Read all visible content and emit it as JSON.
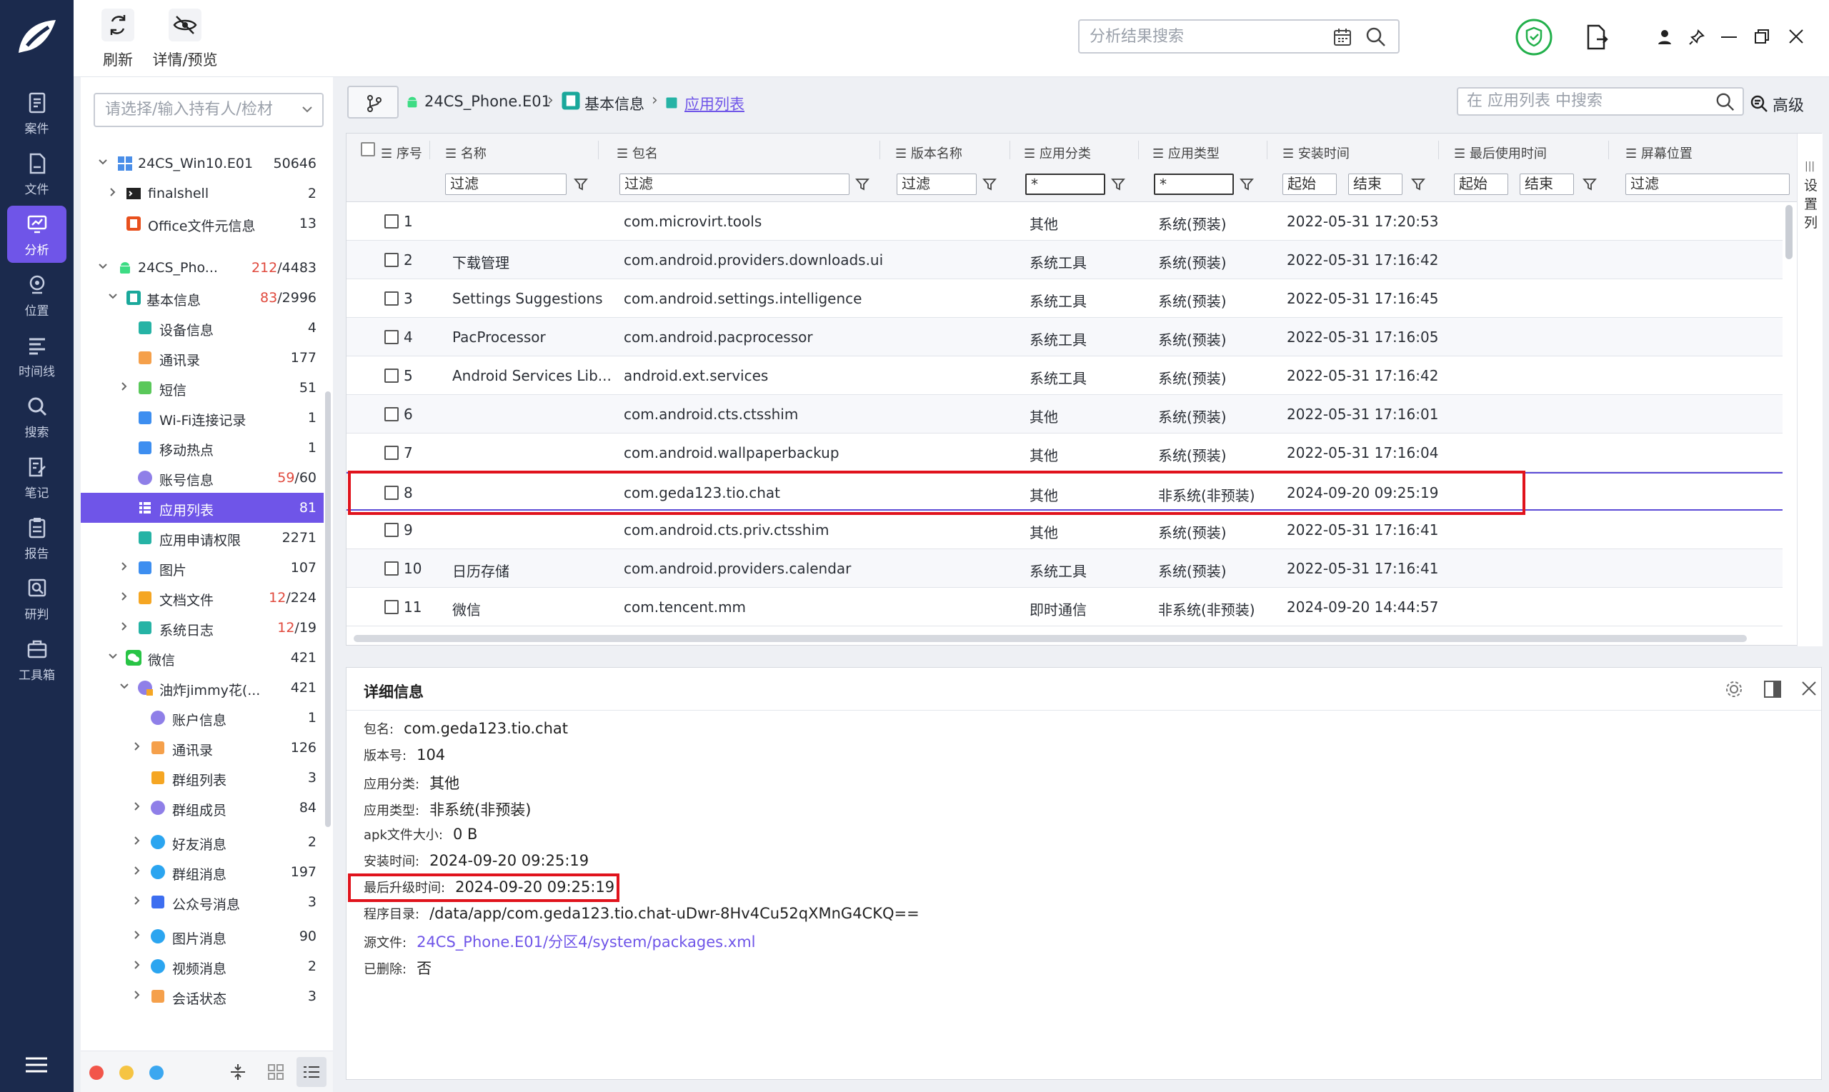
{
  "nav": {
    "items": [
      {
        "label": "案件",
        "icon": "case-icon"
      },
      {
        "label": "文件",
        "icon": "file-icon"
      },
      {
        "label": "分析",
        "icon": "analysis-icon",
        "active": true
      },
      {
        "label": "位置",
        "icon": "location-icon"
      },
      {
        "label": "时间线",
        "icon": "timeline-icon"
      },
      {
        "label": "搜索",
        "icon": "search-icon"
      },
      {
        "label": "笔记",
        "icon": "note-icon"
      },
      {
        "label": "报告",
        "icon": "report-icon"
      },
      {
        "label": "研判",
        "icon": "judge-icon"
      },
      {
        "label": "工具箱",
        "icon": "toolbox-icon"
      }
    ]
  },
  "toolbar": {
    "refresh_label": "刷新",
    "detail_label": "详情/预览",
    "search_placeholder": "分析结果搜索"
  },
  "tree": {
    "holder_placeholder": "请选择/输入持有人/检材",
    "rows": [
      {
        "label": "24CS_Win10.E01",
        "count": "50646"
      },
      {
        "label": "finalshell",
        "count": "2"
      },
      {
        "label": "Office文件元信息",
        "count": "13"
      },
      {
        "label": "24CS_Pho...",
        "count_hl": "212",
        "count": "/4483"
      },
      {
        "label": "基本信息",
        "count_hl": "83",
        "count": "/2996"
      },
      {
        "label": "设备信息",
        "count": "4"
      },
      {
        "label": "通讯录",
        "count": "177"
      },
      {
        "label": "短信",
        "count": "51"
      },
      {
        "label": "Wi-Fi连接记录",
        "count": "1"
      },
      {
        "label": "移动热点",
        "count": "1"
      },
      {
        "label": "账号信息",
        "count_hl": "59",
        "count": "/60"
      },
      {
        "label": "应用列表",
        "count": "81"
      },
      {
        "label": "应用申请权限",
        "count": "2271"
      },
      {
        "label": "图片",
        "count": "107"
      },
      {
        "label": "文档文件",
        "count_hl": "12",
        "count": "/224"
      },
      {
        "label": "系统日志",
        "count_hl": "12",
        "count": "/19"
      },
      {
        "label": "微信",
        "count": "421"
      },
      {
        "label": "油炸jimmy花(...",
        "count": "421"
      },
      {
        "label": "账户信息",
        "count": "1"
      },
      {
        "label": "通讯录",
        "count": "126"
      },
      {
        "label": "群组列表",
        "count": "3"
      },
      {
        "label": "群组成员",
        "count": "84"
      },
      {
        "label": "好友消息",
        "count": "2"
      },
      {
        "label": "群组消息",
        "count": "197"
      },
      {
        "label": "公众号消息",
        "count": "3"
      },
      {
        "label": "图片消息",
        "count": "90"
      },
      {
        "label": "视频消息",
        "count": "2"
      },
      {
        "label": "会话状态",
        "count": "3"
      }
    ]
  },
  "breadcrumb": {
    "device": "24CS_Phone.E01",
    "category": "基本信息",
    "current": "应用列表",
    "search_placeholder": "在 应用列表 中搜索",
    "advanced_label": "高级"
  },
  "grid": {
    "columns": [
      "序号",
      "名称",
      "包名",
      "版本名称",
      "应用分类",
      "应用类型",
      "安装时间",
      "最后使用时间",
      "屏幕位置"
    ],
    "filters": {
      "name": "过滤",
      "package": "过滤",
      "version": "过滤",
      "category": "*",
      "type": "*",
      "install_start": "起始",
      "install_end": "结束",
      "lastuse_start": "起始",
      "lastuse_end": "结束",
      "screen": "过滤"
    },
    "side_label": "设置列",
    "rows": [
      {
        "no": "1",
        "name": "",
        "pkg": "com.microvirt.tools",
        "cat": "其他",
        "type": "系统(预装)",
        "install": "2022-05-31 17:20:53"
      },
      {
        "no": "2",
        "name": "下载管理",
        "pkg": "com.android.providers.downloads.ui",
        "cat": "系统工具",
        "type": "系统(预装)",
        "install": "2022-05-31 17:16:42"
      },
      {
        "no": "3",
        "name": "Settings Suggestions",
        "pkg": "com.android.settings.intelligence",
        "cat": "系统工具",
        "type": "系统(预装)",
        "install": "2022-05-31 17:16:45"
      },
      {
        "no": "4",
        "name": "PacProcessor",
        "pkg": "com.android.pacprocessor",
        "cat": "系统工具",
        "type": "系统(预装)",
        "install": "2022-05-31 17:16:05"
      },
      {
        "no": "5",
        "name": "Android Services Lib...",
        "pkg": "android.ext.services",
        "cat": "系统工具",
        "type": "系统(预装)",
        "install": "2022-05-31 17:16:42"
      },
      {
        "no": "6",
        "name": "",
        "pkg": "com.android.cts.ctsshim",
        "cat": "其他",
        "type": "系统(预装)",
        "install": "2022-05-31 17:16:01"
      },
      {
        "no": "7",
        "name": "",
        "pkg": "com.android.wallpaperbackup",
        "cat": "其他",
        "type": "系统(预装)",
        "install": "2022-05-31 17:16:04"
      },
      {
        "no": "8",
        "name": "",
        "pkg": "com.geda123.tio.chat",
        "cat": "其他",
        "type": "非系统(非预装)",
        "install": "2024-09-20 09:25:19"
      },
      {
        "no": "9",
        "name": "",
        "pkg": "com.android.cts.priv.ctsshim",
        "cat": "其他",
        "type": "系统(预装)",
        "install": "2022-05-31 17:16:41"
      },
      {
        "no": "10",
        "name": "日历存储",
        "pkg": "com.android.providers.calendar",
        "cat": "系统工具",
        "type": "系统(预装)",
        "install": "2022-05-31 17:16:41"
      },
      {
        "no": "11",
        "name": "微信",
        "pkg": "com.tencent.mm",
        "cat": "即时通信",
        "type": "非系统(非预装)",
        "install": "2024-09-20 14:44:57"
      }
    ]
  },
  "detail": {
    "title": "详细信息",
    "fields": [
      {
        "k": "包名:",
        "v": "com.geda123.tio.chat"
      },
      {
        "k": "版本号:",
        "v": "104"
      },
      {
        "k": "应用分类:",
        "v": "其他"
      },
      {
        "k": "应用类型:",
        "v": "非系统(非预装)"
      },
      {
        "k": "apk文件大小:",
        "v": "0 B"
      },
      {
        "k": "安装时间:",
        "v": "2024-09-20 09:25:19"
      },
      {
        "k": "最后升级时间:",
        "v": "2024-09-20 09:25:19"
      },
      {
        "k": "程序目录:",
        "v": "/data/app/com.geda123.tio.chat-uDwr-8Hv4Cu52qXMnG4CKQ=="
      },
      {
        "k": "源文件:",
        "v": "24CS_Phone.E01/分区4/system/packages.xml"
      },
      {
        "k": "已删除:",
        "v": "否"
      }
    ]
  },
  "colors": {
    "accent": "#6f55e8",
    "rail": "#1b2a4d",
    "highlight": "#e0131c",
    "count_red": "#e0493d"
  }
}
